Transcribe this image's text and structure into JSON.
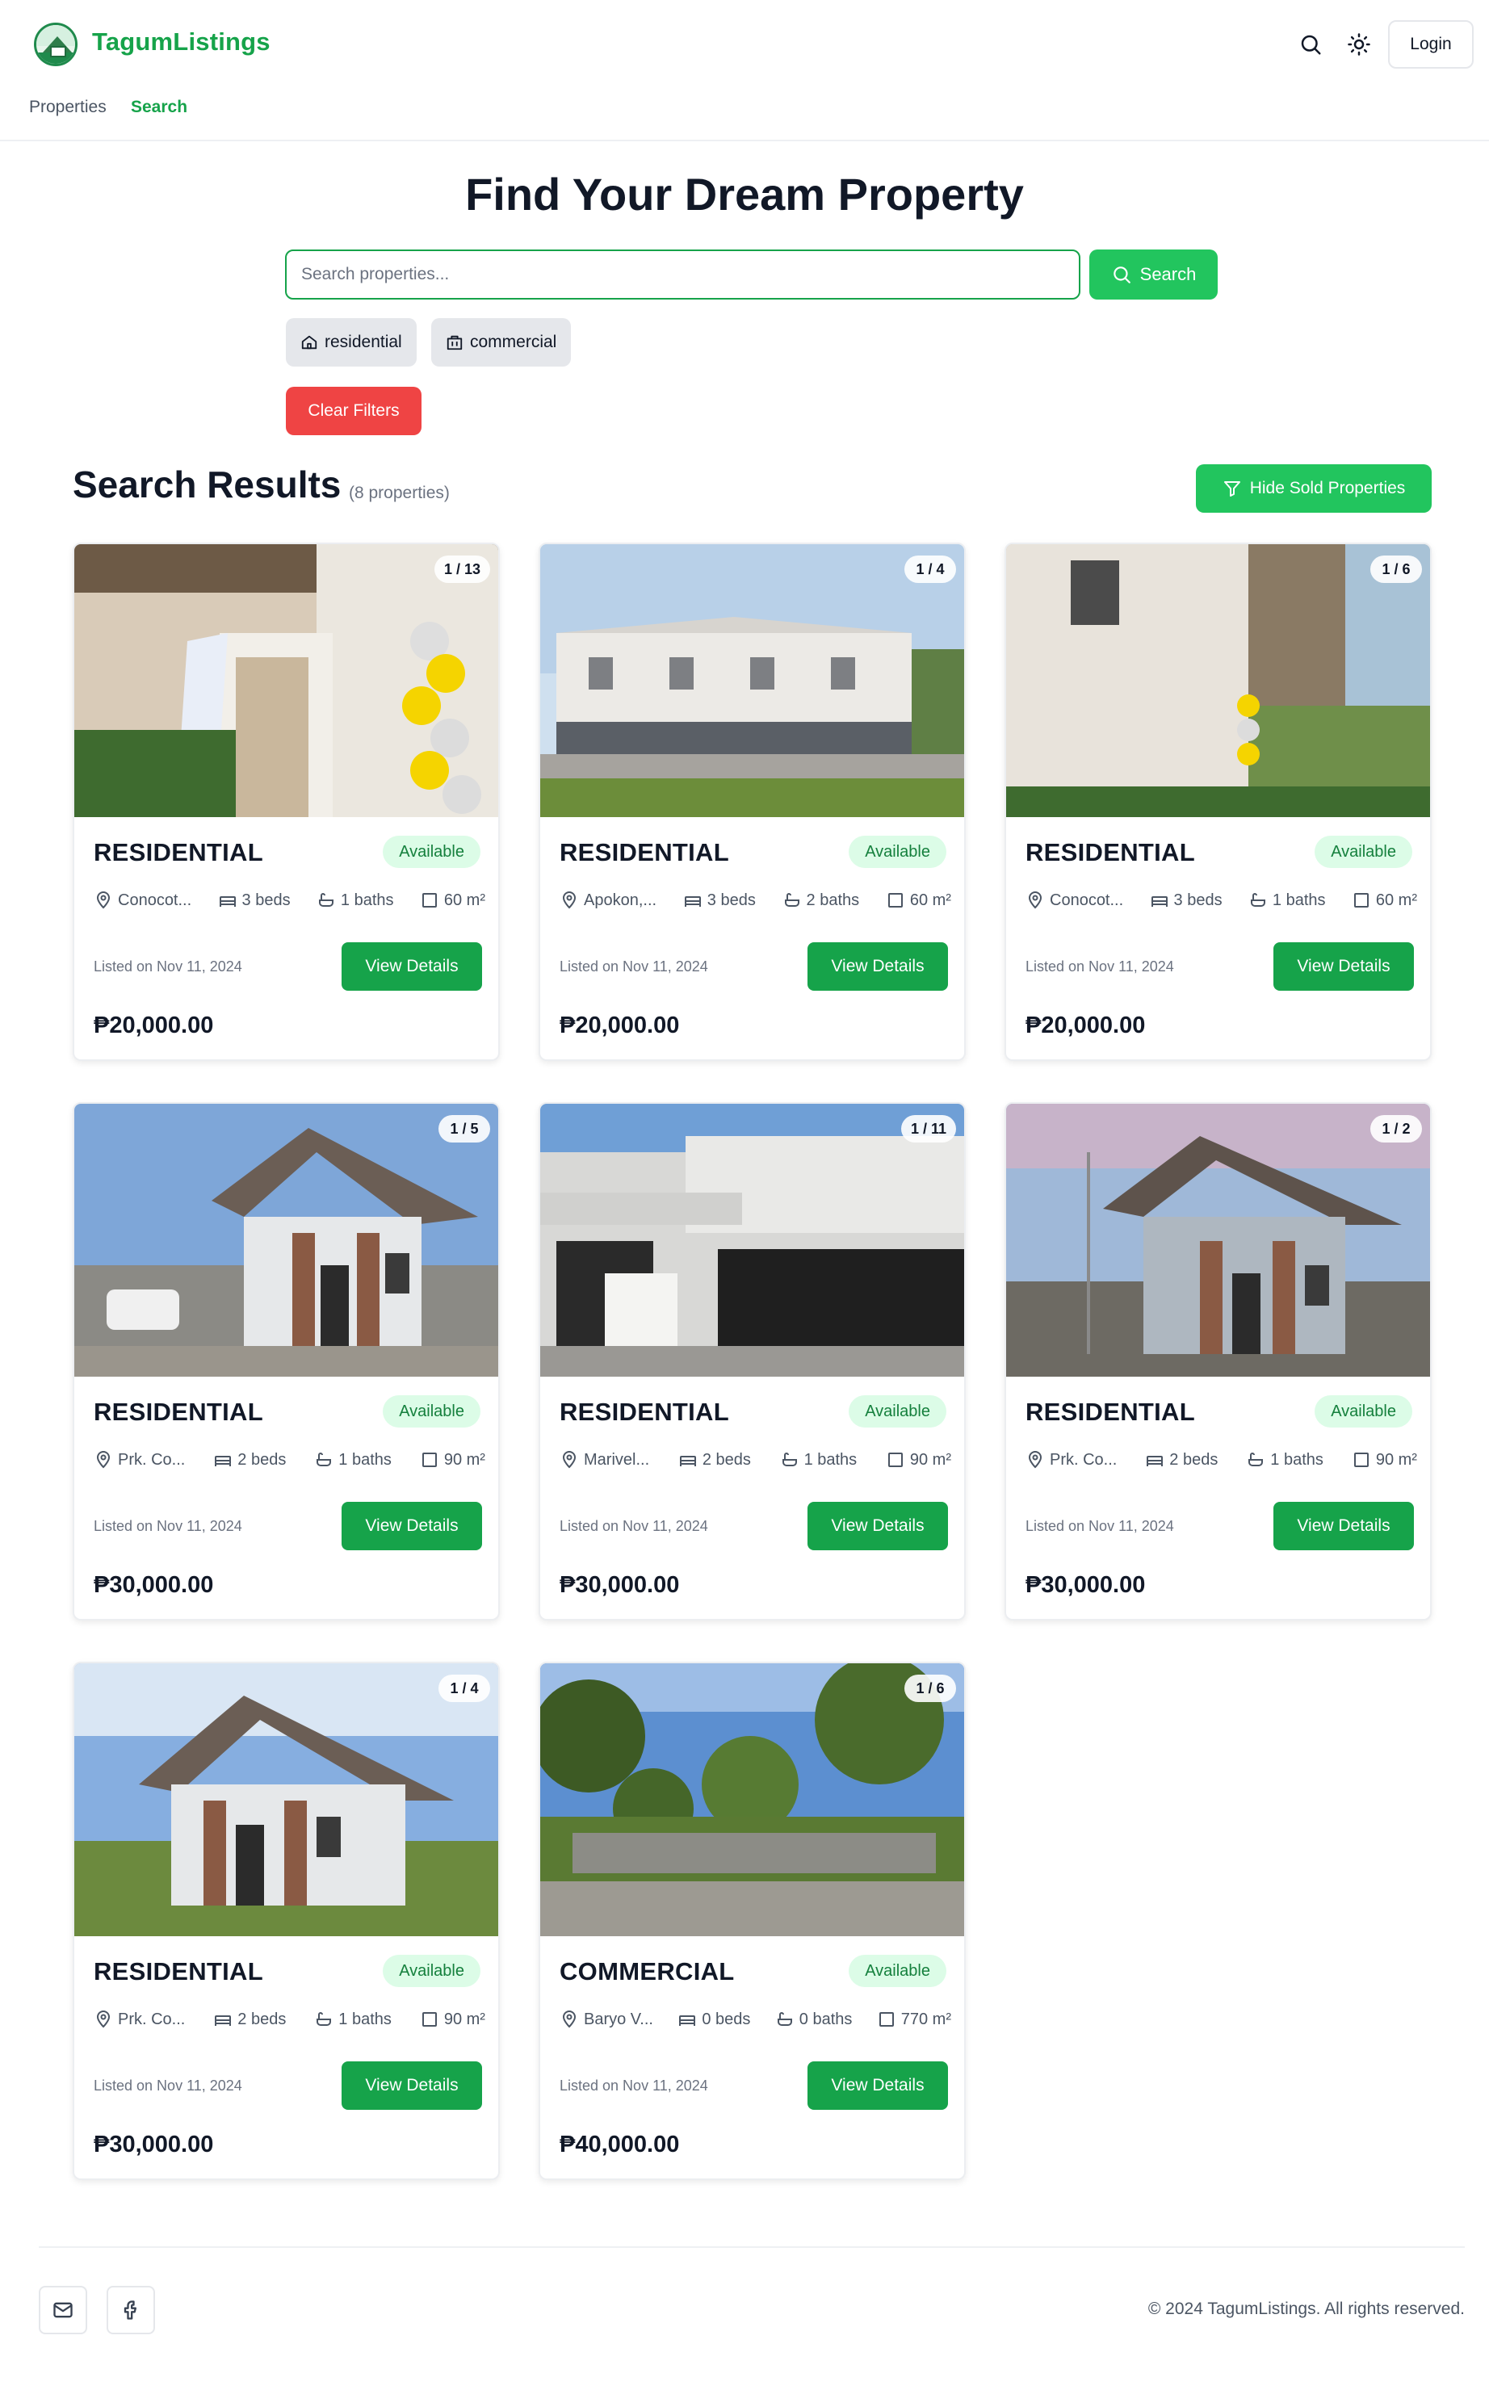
{
  "header": {
    "brand": "TagumListings",
    "nav": [
      "Properties",
      "Search"
    ],
    "login_label": "Login",
    "icons": [
      "search-icon",
      "sun-icon"
    ]
  },
  "hero": {
    "title": "Find Your Dream Property",
    "search_placeholder": "Search properties...",
    "search_label": "Search",
    "filters": [
      "residential",
      "commercial"
    ],
    "clear_label": "Clear Filters"
  },
  "results": {
    "title": "Search Results",
    "count": "(8 properties)",
    "hide_sold_label": "Hide Sold Properties"
  },
  "cards": [
    {
      "counter": "1 / 13",
      "type": "RESIDENTIAL",
      "status": "Available",
      "location": "Conocot...",
      "beds": "3 beds",
      "baths": "1 baths",
      "area": "60 m²",
      "listed": "Listed on Nov 11, 2024",
      "button": "View Details",
      "price": "₱20,000.00"
    },
    {
      "counter": "1 / 4",
      "type": "RESIDENTIAL",
      "status": "Available",
      "location": "Apokon,...",
      "beds": "3 beds",
      "baths": "2 baths",
      "area": "60 m²",
      "listed": "Listed on Nov 11, 2024",
      "button": "View Details",
      "price": "₱20,000.00"
    },
    {
      "counter": "1 / 6",
      "type": "RESIDENTIAL",
      "status": "Available",
      "location": "Conocot...",
      "beds": "3 beds",
      "baths": "1 baths",
      "area": "60 m²",
      "listed": "Listed on Nov 11, 2024",
      "button": "View Details",
      "price": "₱20,000.00"
    },
    {
      "counter": "1 / 5",
      "type": "RESIDENTIAL",
      "status": "Available",
      "location": "Prk. Co...",
      "beds": "2 beds",
      "baths": "1 baths",
      "area": "90 m²",
      "listed": "Listed on Nov 11, 2024",
      "button": "View Details",
      "price": "₱30,000.00"
    },
    {
      "counter": "1 / 11",
      "type": "RESIDENTIAL",
      "status": "Available",
      "location": "Marivel...",
      "beds": "2 beds",
      "baths": "1 baths",
      "area": "90 m²",
      "listed": "Listed on Nov 11, 2024",
      "button": "View Details",
      "price": "₱30,000.00"
    },
    {
      "counter": "1 / 2",
      "type": "RESIDENTIAL",
      "status": "Available",
      "location": "Prk. Co...",
      "beds": "2 beds",
      "baths": "1 baths",
      "area": "90 m²",
      "listed": "Listed on Nov 11, 2024",
      "button": "View Details",
      "price": "₱30,000.00"
    },
    {
      "counter": "1 / 4",
      "type": "RESIDENTIAL",
      "status": "Available",
      "location": "Prk. Co...",
      "beds": "2 beds",
      "baths": "1 baths",
      "area": "90 m²",
      "listed": "Listed on Nov 11, 2024",
      "button": "View Details",
      "price": "₱30,000.00"
    },
    {
      "counter": "1 / 6",
      "type": "COMMERCIAL",
      "status": "Available",
      "location": "Baryo V...",
      "beds": "0 beds",
      "baths": "0 baths",
      "area": "770 m²",
      "listed": "Listed on Nov 11, 2024",
      "button": "View Details",
      "price": "₱40,000.00"
    }
  ],
  "footer": {
    "copyright": "© 2024 TagumListings. All rights reserved.",
    "icons": [
      "mail-icon",
      "facebook-icon"
    ]
  },
  "colors": {
    "brand_green": "#16a34a",
    "accent_green": "#22c55e",
    "danger_red": "#ef4444",
    "available_bg": "#dcfce7"
  }
}
